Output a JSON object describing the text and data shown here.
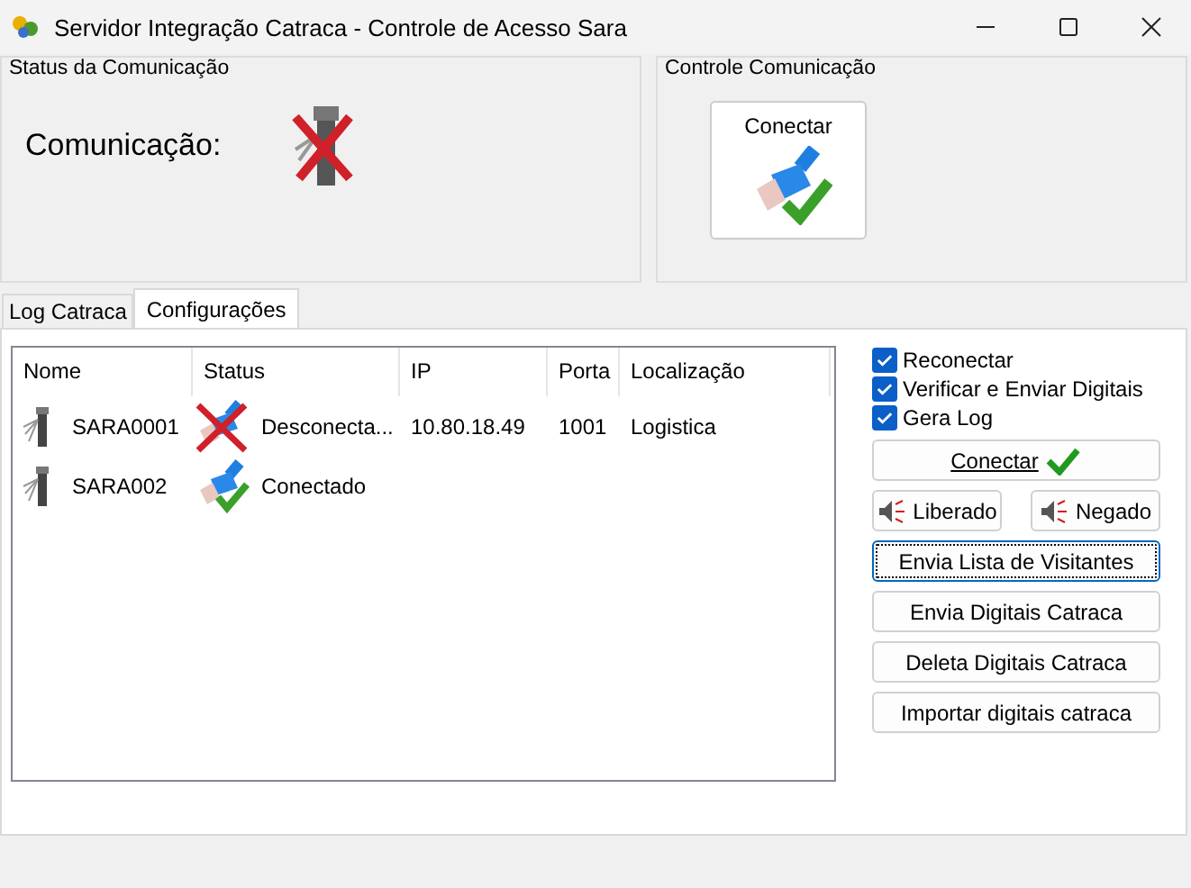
{
  "window": {
    "title": "Servidor Integração Catraca - Controle de Acesso Sara"
  },
  "status_group": {
    "title": "Status da Comunicação",
    "label": "Comunicação:",
    "connected": false
  },
  "control_group": {
    "title": "Controle Comunicação",
    "button": "Conectar"
  },
  "tabs": [
    {
      "label": "Log Catraca",
      "selected": false
    },
    {
      "label": "Configurações",
      "selected": true
    }
  ],
  "table": {
    "columns": [
      "Nome",
      "Status",
      "IP",
      "Porta",
      "Localização"
    ],
    "rows": [
      {
        "name": "SARA0001",
        "connected": false,
        "status_text": "Desconecta...",
        "ip": "10.80.18.49",
        "port": "1001",
        "location": "Logistica"
      },
      {
        "name": "SARA002",
        "connected": true,
        "status_text": "Conectado"
      }
    ]
  },
  "options": [
    {
      "label": "Reconectar",
      "checked": true
    },
    {
      "label": "Verificar e Enviar Digitais",
      "checked": true
    },
    {
      "label": "Gera Log",
      "checked": true
    }
  ],
  "connect_button": {
    "label": "Conectar"
  },
  "sound_buttons": [
    "Liberado",
    "Negado"
  ],
  "actions": [
    {
      "label": "Envia Lista de Visitantes",
      "focused": true
    },
    {
      "label": "Envia Digitais Catraca",
      "focused": false
    },
    {
      "label": "Deleta Digitais Catraca",
      "focused": false
    },
    {
      "label": "Importar digitais catraca",
      "focused": false
    }
  ]
}
